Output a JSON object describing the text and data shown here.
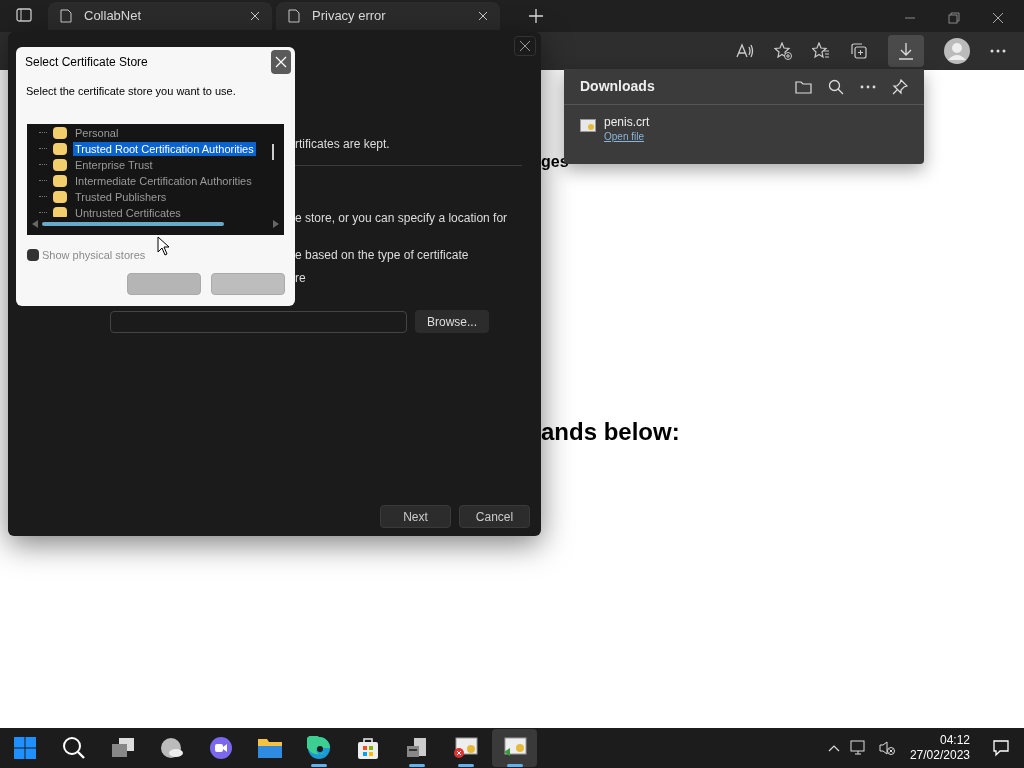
{
  "browser": {
    "tabs": [
      {
        "title": "CollabNet"
      },
      {
        "title": "Privacy error"
      }
    ]
  },
  "page": {
    "texts": [
      {
        "text": "ges",
        "kind": "small"
      },
      {
        "text": "ands below:",
        "kind": "large"
      }
    ]
  },
  "import_wizard": {
    "lines": [
      "rtificates are kept.",
      "e store, or you can specify a location for",
      "e based on the type of certificate",
      "re"
    ],
    "browse_button": "Browse...",
    "buttons": [
      "Next",
      "Cancel"
    ]
  },
  "certificate_store_dialog": {
    "title": "Select Certificate Store",
    "prompt": "Select the certificate store you want to use.",
    "stores": [
      {
        "name": "Personal",
        "selected": false
      },
      {
        "name": "Trusted Root Certification Authorities",
        "selected": true
      },
      {
        "name": "Enterprise Trust",
        "selected": false
      },
      {
        "name": "Intermediate Certification Authorities",
        "selected": false
      },
      {
        "name": "Trusted Publishers",
        "selected": false
      },
      {
        "name": "Untrusted Certificates",
        "selected": false
      }
    ],
    "show_physical_stores": {
      "label": "Show physical stores",
      "checked": false
    }
  },
  "downloads": {
    "title": "Downloads",
    "items": [
      {
        "file": "penis.crt",
        "action": "Open file"
      }
    ]
  },
  "taskbar": {
    "apps": [
      {
        "kind": "start",
        "running": false,
        "selected": false
      },
      {
        "kind": "search",
        "running": false,
        "selected": false
      },
      {
        "kind": "taskview",
        "running": false,
        "selected": false
      },
      {
        "kind": "weather",
        "running": false,
        "selected": false
      },
      {
        "kind": "chat",
        "running": false,
        "selected": false
      },
      {
        "kind": "folder",
        "running": false,
        "selected": false
      },
      {
        "kind": "edge",
        "running": true,
        "selected": false
      },
      {
        "kind": "store",
        "running": false,
        "selected": false
      },
      {
        "kind": "server",
        "running": true,
        "selected": false
      },
      {
        "kind": "certerror",
        "running": true,
        "selected": false
      },
      {
        "kind": "certimport",
        "running": true,
        "selected": true
      }
    ],
    "time": "04:12",
    "date": "27/02/2023"
  }
}
